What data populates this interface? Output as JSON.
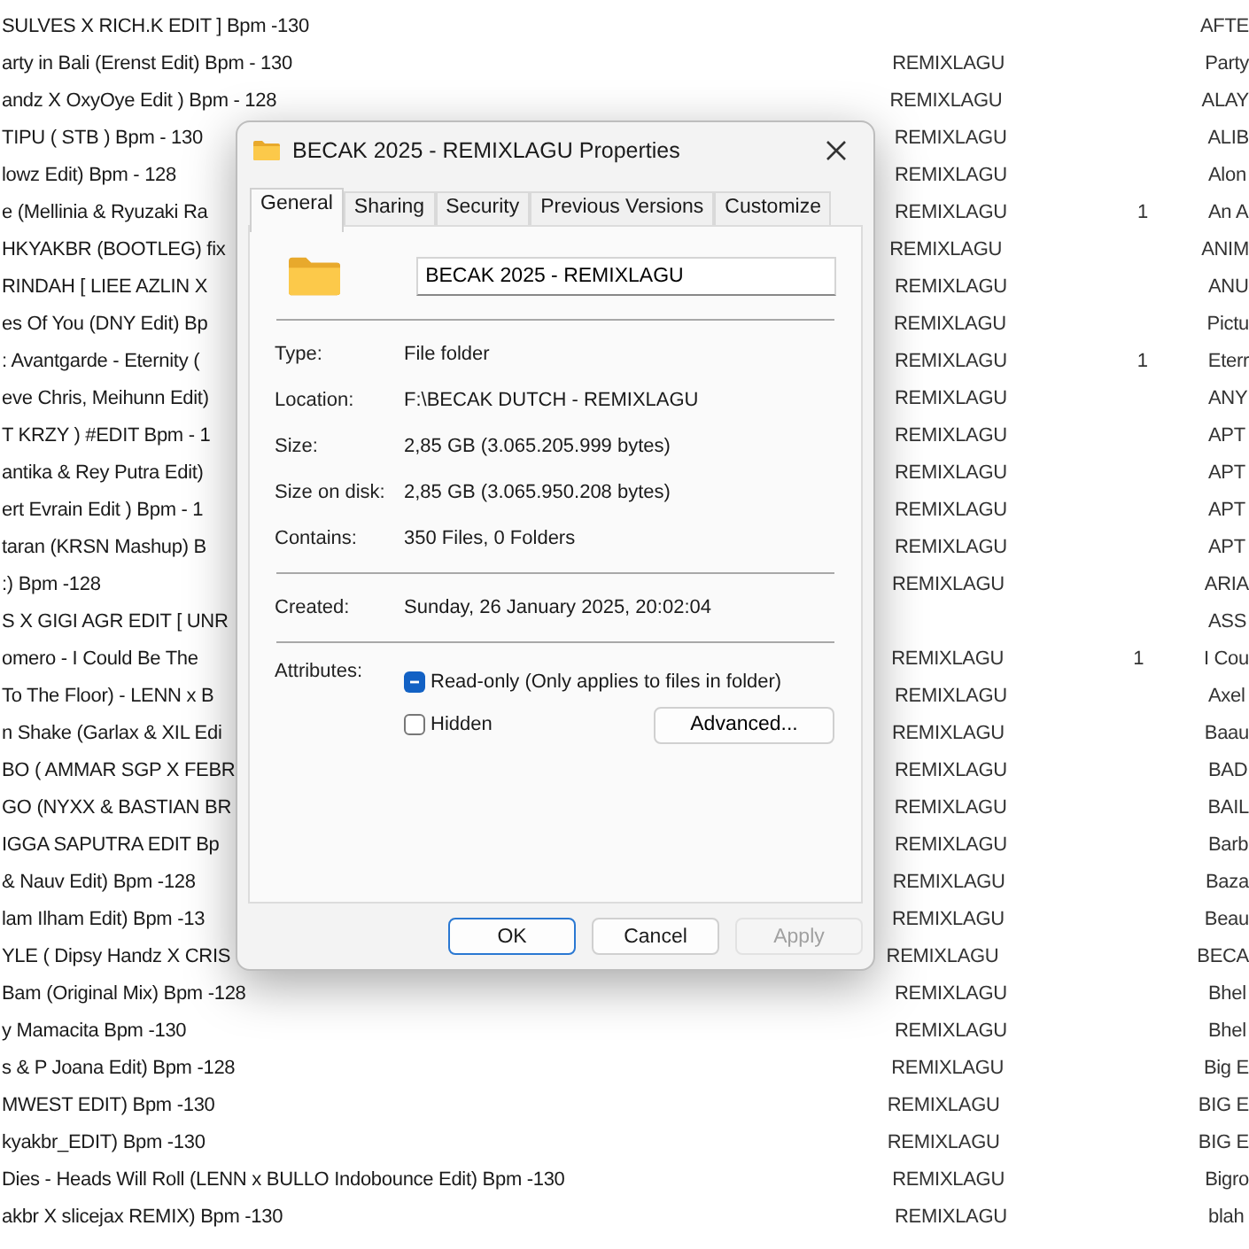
{
  "file_list": {
    "rows": [
      {
        "title": "SULVES X RICH.K EDIT ]  Bpm -130",
        "column_4": "AFTE"
      },
      {
        "title": "arty in Bali (Erenst Edit)  Bpm - 130",
        "album": "REMIXLAGU",
        "column_4": "Party"
      },
      {
        "title": "andz X OxyOye Edit )  Bpm - 128",
        "album": "REMIXLAGU",
        "column_4": "ALAY"
      },
      {
        "title": "TIPU ( STB )  Bpm - 130",
        "album": "REMIXLAGU",
        "column_4": "ALIB"
      },
      {
        "title": "lowz Edit)  Bpm - 128",
        "album": "REMIXLAGU",
        "column_4": "Alon"
      },
      {
        "title": "e (Mellinia & Ryuzaki Ra",
        "album": "REMIXLAGU",
        "number": "1",
        "column_4": "An A"
      },
      {
        "title": "HKYAKBR  (BOOTLEG) fix",
        "album": "REMIXLAGU",
        "column_4": "ANIM"
      },
      {
        "title": "RINDAH [ LIEE AZLIN X",
        "album": "REMIXLAGU",
        "column_4": "ANU"
      },
      {
        "title": "es Of You (DNY Edit)  Bp",
        "album": "REMIXLAGU",
        "column_4": "Pictu"
      },
      {
        "title": ": Avantgarde - Eternity (",
        "album": "REMIXLAGU",
        "number": "1",
        "column_4": "Eterr"
      },
      {
        "title": "eve Chris, Meihunn Edit)",
        "album": "REMIXLAGU",
        "column_4": "ANY"
      },
      {
        "title": "T KRZY ) #EDIT  Bpm - 1",
        "album": "REMIXLAGU",
        "column_4": "APT"
      },
      {
        "title": "antika & Rey Putra Edit)",
        "album": "REMIXLAGU",
        "column_4": "APT"
      },
      {
        "title": "ert Evrain Edit )  Bpm - 1",
        "album": "REMIXLAGU",
        "column_4": "APT"
      },
      {
        "title": "taran (KRSN Mashup)  B",
        "album": "REMIXLAGU",
        "column_4": "APT"
      },
      {
        "title": ":)  Bpm -128",
        "album": "REMIXLAGU",
        "column_4": "ARIA"
      },
      {
        "title": "S X GIGI AGR EDIT [ UNR",
        "column_4": "ASS"
      },
      {
        "title": "omero - I Could Be The",
        "album": "REMIXLAGU",
        "number": "1",
        "column_4": "I Cou"
      },
      {
        "title": "To The Floor) - LENN x B",
        "album": "REMIXLAGU",
        "column_4": "Axel"
      },
      {
        "title": "n Shake (Garlax & XIL Edi",
        "album": "REMIXLAGU",
        "column_4": "Baau"
      },
      {
        "title": "BO ( AMMAR SGP X FEBR",
        "album": "REMIXLAGU",
        "column_4": "BAD"
      },
      {
        "title": "GO (NYXX & BASTIAN BR",
        "album": "REMIXLAGU",
        "column_4": "BAIL"
      },
      {
        "title": "IGGA SAPUTRA EDIT  Bp",
        "album": "REMIXLAGU",
        "column_4": "Barb"
      },
      {
        "title": "& Nauv Edit)  Bpm -128",
        "album": "REMIXLAGU",
        "column_4": "Baza"
      },
      {
        "title": "lam Ilham Edit)  Bpm -13",
        "album": "REMIXLAGU",
        "column_4": "Beau"
      },
      {
        "title": "YLE ( Dipsy Handz X CRIS",
        "album": "REMIXLAGU",
        "column_4": "BECA"
      },
      {
        "title": "Bam (Original Mix)  Bpm -128",
        "album": "REMIXLAGU",
        "column_4": "Bhel"
      },
      {
        "title": "y Mamacita  Bpm -130",
        "album": "REMIXLAGU",
        "column_4": "Bhel"
      },
      {
        "title": "s & P Joana Edit)  Bpm -128",
        "album": "REMIXLAGU",
        "column_4": "Big E"
      },
      {
        "title": "MWEST EDIT)  Bpm -130",
        "album": "REMIXLAGU",
        "column_4": "BIG E"
      },
      {
        "title": "kyakbr_EDIT)  Bpm -130",
        "album": "REMIXLAGU",
        "column_4": "BIG E"
      },
      {
        "title": "Dies - Heads Will Roll (LENN x BULLO Indobounce Edit)  Bpm -130",
        "album": "REMIXLAGU",
        "column_4": "Bigro"
      },
      {
        "title": "akbr X slicejax REMIX)  Bpm -130",
        "album": "REMIXLAGU",
        "column_4": "blah"
      }
    ]
  },
  "dialog": {
    "title": "BECAK 2025 - REMIXLAGU Properties",
    "tabs": [
      {
        "label": "General",
        "selected": true
      },
      {
        "label": "Sharing",
        "selected": false
      },
      {
        "label": "Security",
        "selected": false
      },
      {
        "label": "Previous Versions",
        "selected": false
      },
      {
        "label": "Customize",
        "selected": false
      }
    ],
    "name_field": {
      "value": "BECAK 2025 - REMIXLAGU"
    },
    "groups": [
      [
        {
          "label": "Type:",
          "value": "File folder"
        },
        {
          "label": "Location:",
          "value": "F:\\BECAK DUTCH - REMIXLAGU"
        },
        {
          "label": "Size:",
          "value": "2,85 GB (3.065.205.999 bytes)"
        },
        {
          "label": "Size on disk:",
          "value": "2,85 GB (3.065.950.208 bytes)"
        },
        {
          "label": "Contains:",
          "value": "350 Files, 0 Folders"
        }
      ],
      [
        {
          "label": "Created:",
          "value": "Sunday, 26 January 2025, 20:02:04"
        }
      ]
    ],
    "attributes": {
      "label": "Attributes:",
      "checkboxes": [
        {
          "label": "Read-only (Only applies to files in folder)",
          "checked": true,
          "mixed": true
        },
        {
          "label": "Hidden",
          "checked": false,
          "mixed": false
        }
      ],
      "advanced_button": "Advanced..."
    },
    "buttons": [
      {
        "label": "OK",
        "kind": "default",
        "disabled": false
      },
      {
        "label": "Cancel",
        "kind": "normal",
        "disabled": false
      },
      {
        "label": "Apply",
        "kind": "normal",
        "disabled": true
      }
    ]
  }
}
